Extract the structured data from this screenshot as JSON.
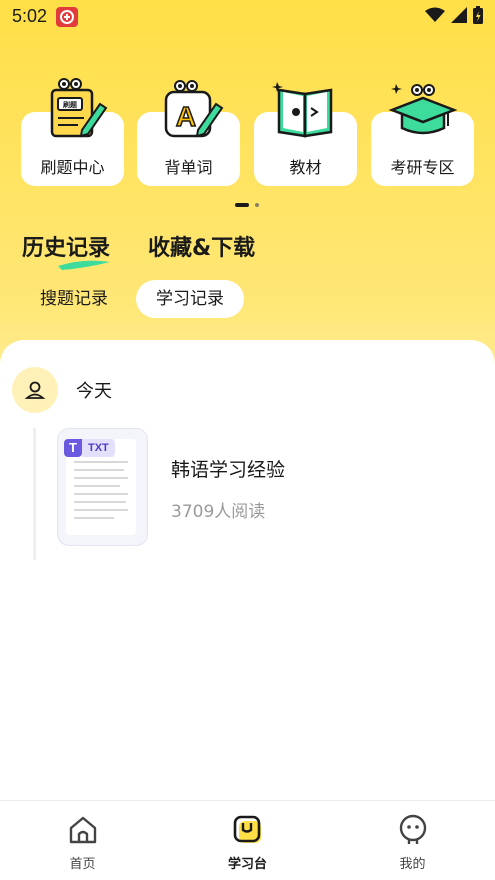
{
  "status_bar": {
    "time": "5:02",
    "notification_icon": "notification-app-icon",
    "icons": [
      "wifi-icon",
      "cellular-signal-icon",
      "battery-charging-icon"
    ]
  },
  "features": [
    {
      "label": "刷题中心",
      "icon": "practice-notebook-icon"
    },
    {
      "label": "背单词",
      "icon": "vocabulary-card-icon"
    },
    {
      "label": "教材",
      "icon": "textbook-icon"
    },
    {
      "label": "考研专区",
      "icon": "graduate-cap-icon"
    }
  ],
  "feature_badge_text": "刷题",
  "feature_vocab_letter": "A",
  "pager": {
    "pages": 2,
    "current": 1
  },
  "section_tabs": {
    "history": "历史记录",
    "favorites": "收藏&下载",
    "active": "history"
  },
  "sub_tabs": {
    "search": "搜题记录",
    "study": "学习记录",
    "active": "study"
  },
  "timeline": {
    "day_label": "今天",
    "records": [
      {
        "title": "韩语学习经验",
        "reads": "3709人阅读",
        "file_type": "TXT",
        "type_letter": "T"
      }
    ]
  },
  "bottom_nav": {
    "items": [
      {
        "label": "首页",
        "icon": "home-icon"
      },
      {
        "label": "学习台",
        "icon": "study-desk-icon"
      },
      {
        "label": "我的",
        "icon": "profile-face-icon"
      }
    ],
    "active_index": 1
  },
  "colors": {
    "accent_yellow": "#FFDF47",
    "card_white": "#FFFFFF",
    "text_dark": "#1A1A1A",
    "text_muted": "#9A9A9A",
    "brush_green": "#3EDC9C",
    "doc_purple": "#6A5AE0"
  }
}
